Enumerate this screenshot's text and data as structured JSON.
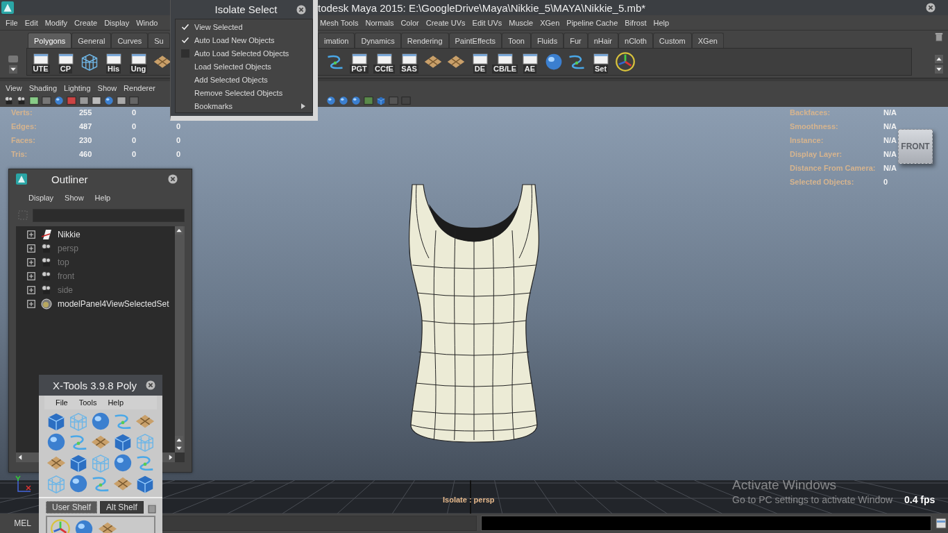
{
  "title_bar": {
    "title": "todesk Maya 2015: E:\\GoogleDrive\\Maya\\Nikkie_5\\MAYA\\Nikkie_5.mb*"
  },
  "menubar": {
    "left": [
      "File",
      "Edit",
      "Modify",
      "Create",
      "Display",
      "Windo"
    ],
    "right": [
      "Mesh Tools",
      "Normals",
      "Color",
      "Create UVs",
      "Edit UVs",
      "Muscle",
      "XGen",
      "Pipeline Cache",
      "Bifrost",
      "Help"
    ]
  },
  "shelf": {
    "tabs_left": [
      {
        "label": "Polygons",
        "selected": true
      },
      {
        "label": "General",
        "selected": false
      },
      {
        "label": "Curves",
        "selected": false
      },
      {
        "label": "Su",
        "selected": false
      }
    ],
    "tabs_right": [
      {
        "label": "imation",
        "selected": false
      },
      {
        "label": "Dynamics",
        "selected": false
      },
      {
        "label": "Rendering",
        "selected": false
      },
      {
        "label": "PaintEffects",
        "selected": false
      },
      {
        "label": "Toon",
        "selected": false
      },
      {
        "label": "Fluids",
        "selected": false
      },
      {
        "label": "Fur",
        "selected": false
      },
      {
        "label": "nHair",
        "selected": false
      },
      {
        "label": "nCloth",
        "selected": false
      },
      {
        "label": "Custom",
        "selected": false
      },
      {
        "label": "XGen",
        "selected": false
      }
    ],
    "buttons_left": [
      {
        "kind": "labeled",
        "label": "UTE"
      },
      {
        "kind": "labeled",
        "label": "CP"
      },
      {
        "kind": "graphic"
      },
      {
        "kind": "labeled",
        "label": "His"
      },
      {
        "kind": "labeled",
        "label": "Ung"
      },
      {
        "kind": "graphic"
      }
    ],
    "buttons_right": [
      {
        "kind": "graphic"
      },
      {
        "kind": "labeled",
        "label": "PGT"
      },
      {
        "kind": "labeled",
        "label": "CCfE"
      },
      {
        "kind": "labeled",
        "label": "SAS"
      },
      {
        "kind": "graphic"
      },
      {
        "kind": "graphic"
      },
      {
        "kind": "labeled",
        "label": "DE"
      },
      {
        "kind": "labeled",
        "label": "CB/LE"
      },
      {
        "kind": "labeled",
        "label": "AE"
      },
      {
        "kind": "graphic"
      },
      {
        "kind": "graphic"
      },
      {
        "kind": "labeled",
        "label": "Set"
      },
      {
        "kind": "graphic"
      }
    ]
  },
  "panel_menu": [
    "View",
    "Shading",
    "Lighting",
    "Show",
    "Renderer"
  ],
  "hud_left": [
    {
      "label": "Verts:",
      "values": [
        "255",
        "0"
      ]
    },
    {
      "label": "Edges:",
      "values": [
        "487",
        "0",
        "0"
      ]
    },
    {
      "label": "Faces:",
      "values": [
        "230",
        "0",
        "0"
      ]
    },
    {
      "label": "Tris:",
      "values": [
        "460",
        "0",
        "0"
      ]
    }
  ],
  "hud_right": [
    {
      "label": "Backfaces:",
      "value": "N/A"
    },
    {
      "label": "Smoothness:",
      "value": "N/A"
    },
    {
      "label": "Instance:",
      "value": "N/A"
    },
    {
      "label": "Display Layer:",
      "value": "N/A"
    },
    {
      "label": "Distance From Camera:",
      "value": "N/A"
    },
    {
      "label": "Selected Objects:",
      "value": "0"
    }
  ],
  "view_cube": {
    "label": "FRONT"
  },
  "isolate_label": "Isolate : persp",
  "fps": "0.4 fps",
  "os_notice": {
    "title": "Activate Windows",
    "message": "Go to PC settings to activate Window"
  },
  "command_line": {
    "language": "MEL"
  },
  "isolate_select": {
    "title": "Isolate Select",
    "items": [
      {
        "kind": "check",
        "label": "View Selected",
        "checked": true
      },
      {
        "kind": "check",
        "label": "Auto Load New Objects",
        "checked": true
      },
      {
        "kind": "check",
        "label": "Auto Load Selected Objects",
        "checked": false
      },
      {
        "kind": "action",
        "label": "Load Selected Objects"
      },
      {
        "kind": "action",
        "label": "Add Selected Objects"
      },
      {
        "kind": "action",
        "label": "Remove Selected Objects"
      },
      {
        "kind": "submenu",
        "label": "Bookmarks"
      }
    ]
  },
  "outliner": {
    "title": "Outliner",
    "menu": [
      "Display",
      "Show",
      "Help"
    ],
    "items": [
      {
        "kind": "transform",
        "label": "Nikkie",
        "dimmed": false
      },
      {
        "kind": "camera",
        "label": "persp",
        "dimmed": true
      },
      {
        "kind": "camera",
        "label": "top",
        "dimmed": true
      },
      {
        "kind": "camera",
        "label": "front",
        "dimmed": true
      },
      {
        "kind": "camera",
        "label": "side",
        "dimmed": true
      },
      {
        "kind": "set",
        "label": "modelPanel4ViewSelectedSet",
        "dimmed": false
      }
    ]
  },
  "xtools": {
    "title": "X-Tools 3.9.8 Poly",
    "menu": [
      "File",
      "Tools",
      "Help"
    ],
    "tabs": [
      {
        "label": "User Shelf",
        "selected": true
      },
      {
        "label": "Alt Shelf",
        "selected": false
      }
    ]
  }
}
